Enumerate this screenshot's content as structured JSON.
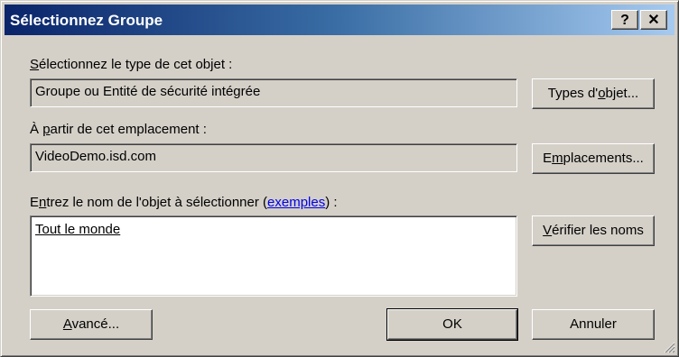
{
  "window": {
    "title": "Sélectionnez Groupe",
    "help_glyph": "?",
    "close_glyph": "✕"
  },
  "object_type": {
    "label_accel": "S",
    "label_rest": "électionnez le type de cet objet :",
    "value": "Groupe ou Entité de sécurité intégrée",
    "button_pre": "Types d'",
    "button_accel": "o",
    "button_post": "bjet..."
  },
  "location": {
    "label_pre": "À ",
    "label_accel": "p",
    "label_post": "artir de cet emplacement :",
    "value": "VideoDemo.isd.com",
    "button_pre": "E",
    "button_accel": "m",
    "button_post": "placements..."
  },
  "object_name": {
    "label_pre": "E",
    "label_accel": "n",
    "label_mid": "trez le nom de l'objet à sélectionner (",
    "label_link": "exemples",
    "label_post": ") :",
    "value": "Tout le monde",
    "check_button_accel": "V",
    "check_button_rest": "érifier les noms"
  },
  "footer": {
    "advanced_accel": "A",
    "advanced_rest": "vancé...",
    "ok": "OK",
    "cancel": "Annuler"
  },
  "colors": {
    "dialog_bg": "#d4d0c8",
    "titlebar_start": "#0a246a",
    "titlebar_end": "#a6caf0",
    "link": "#0000ee"
  }
}
